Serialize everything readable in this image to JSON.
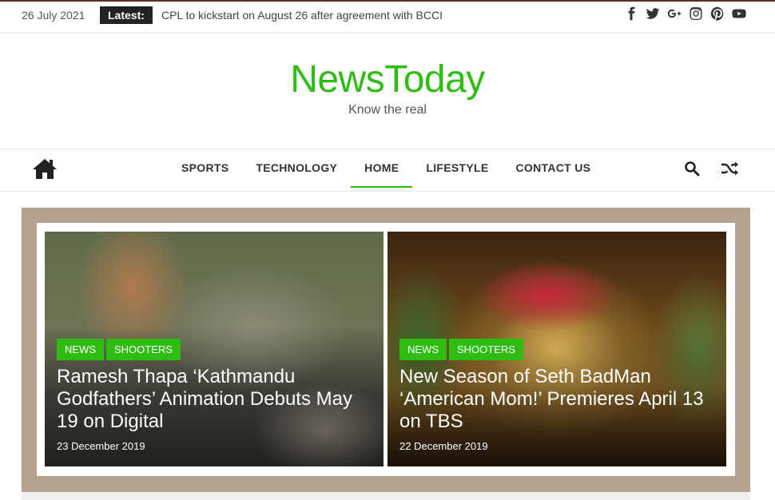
{
  "topbar": {
    "date": "26 July 2021",
    "latest_label": "Latest:",
    "latest_headline": "CPL to kickstart on August 26 after agreement with BCCI",
    "social_icons": [
      "facebook-icon",
      "twitter-icon",
      "google-plus-icon",
      "instagram-icon",
      "pinterest-icon",
      "youtube-icon"
    ]
  },
  "brand": {
    "title": "NewsToday",
    "tagline": "Know the real",
    "accent_color": "#2fbd13"
  },
  "nav": {
    "items": [
      {
        "label": "SPORTS",
        "active": false
      },
      {
        "label": "TECHNOLOGY",
        "active": false
      },
      {
        "label": "HOME",
        "active": true
      },
      {
        "label": "LIFESTYLE",
        "active": false
      },
      {
        "label": "CONTACT US",
        "active": false
      }
    ],
    "icons": [
      "home-icon",
      "search-icon",
      "shuffle-icon"
    ]
  },
  "featured": {
    "posts": [
      {
        "tags": [
          "NEWS",
          "SHOOTERS"
        ],
        "title": "Ramesh Thapa ‘Kathmandu Godfathers’ Animation Debuts May 19 on Digital",
        "date": "23 December 2019"
      },
      {
        "tags": [
          "NEWS",
          "SHOOTERS"
        ],
        "title": "New Season of Seth BadMan ‘American Mom!’ Premieres April 13 on TBS",
        "date": "22 December 2019"
      }
    ]
  }
}
